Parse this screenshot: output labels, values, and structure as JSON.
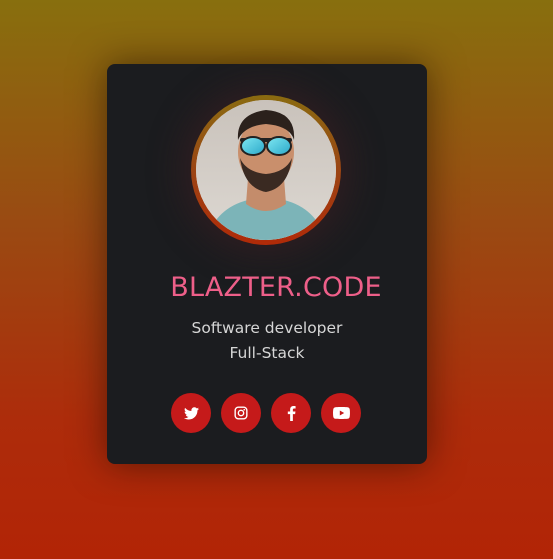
{
  "profile": {
    "name": "BLAZTER.CODE",
    "role_line_1": "Software developer",
    "role_line_2": "Full-Stack",
    "avatar_alt": "profile photo"
  },
  "socials": [
    {
      "name": "twitter",
      "icon": "twitter-icon"
    },
    {
      "name": "instagram",
      "icon": "instagram-icon"
    },
    {
      "name": "facebook",
      "icon": "facebook-icon"
    },
    {
      "name": "youtube",
      "icon": "youtube-icon"
    }
  ],
  "colors": {
    "background_top": "#886f0e",
    "background_bottom": "#b22406",
    "card": "#1b1c1f",
    "name": "#ee5f89",
    "role_text": "#d6d6d6",
    "social_button": "#c51a1a"
  }
}
